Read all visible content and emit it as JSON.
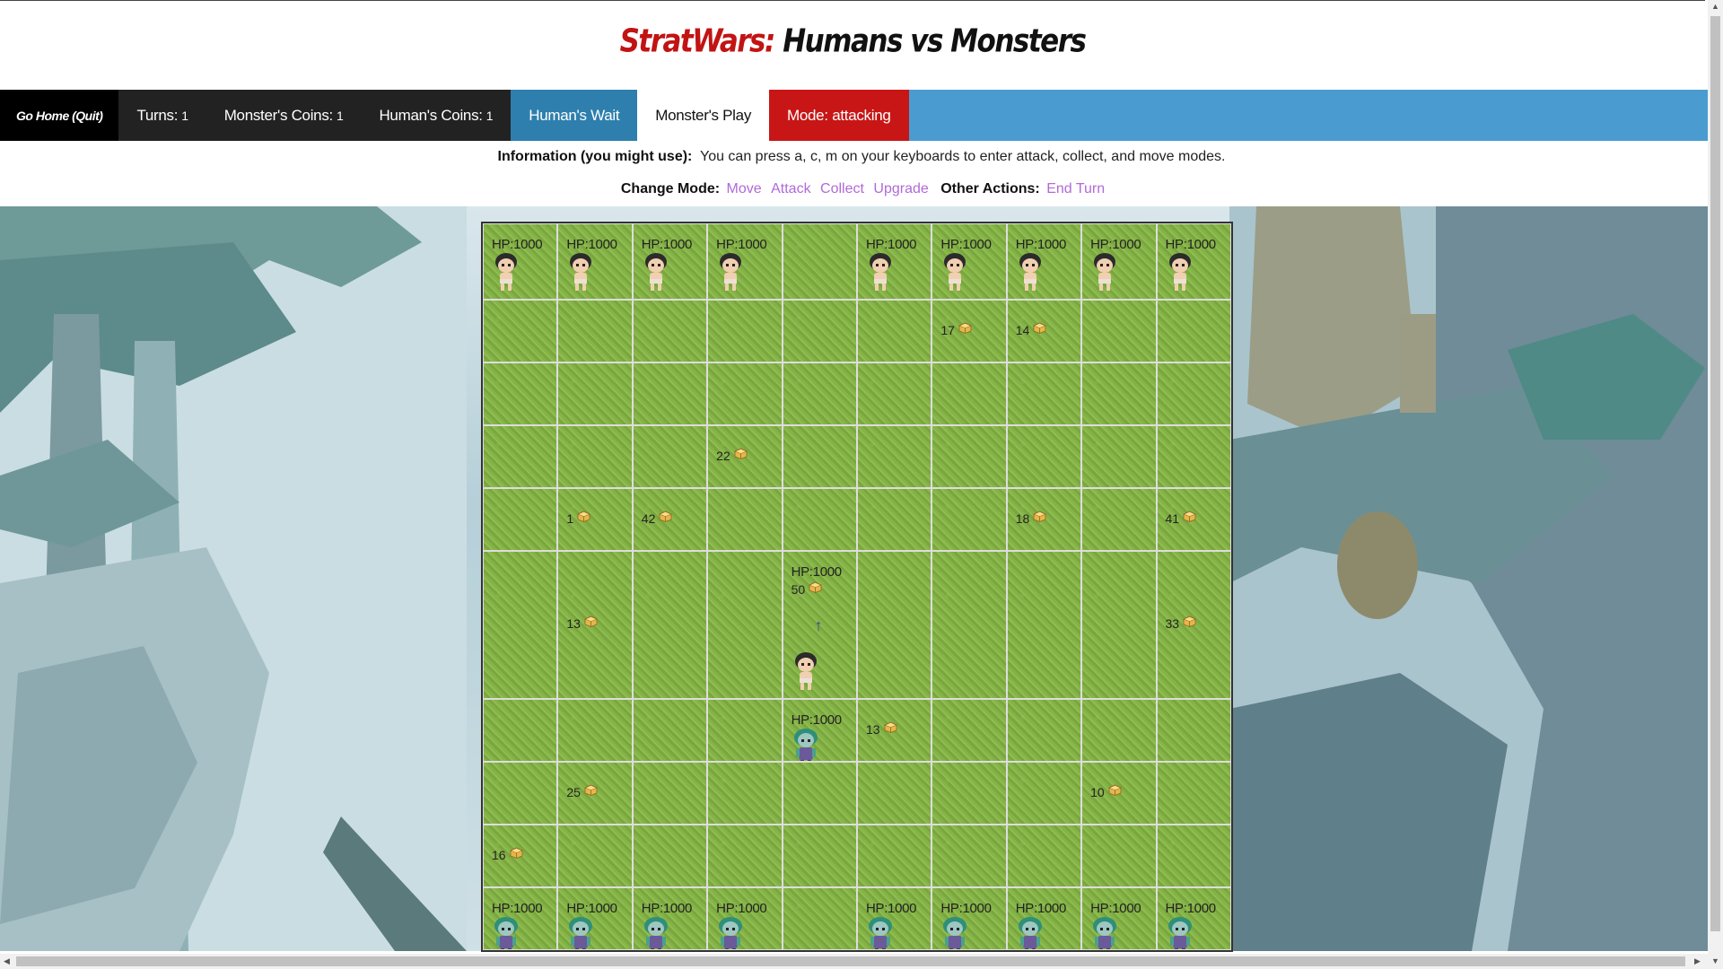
{
  "title": {
    "part1": "StratWars:",
    "part2": "Humans vs Monsters"
  },
  "nav": {
    "home": "Go Home (Quit)",
    "turns_label": "Turns:",
    "turns_value": "1",
    "monster_coins_label": "Monster's Coins:",
    "monster_coins_value": "1",
    "human_coins_label": "Human's Coins:",
    "human_coins_value": "1",
    "human_status": "Human's Wait",
    "monster_status": "Monster's Play",
    "mode_label": "Mode:",
    "mode_value": "attacking"
  },
  "info": {
    "label": "Information (you might use):",
    "text": "You can press a, c, m on your keyboards to enter attack, collect, and move modes."
  },
  "modes": {
    "label": "Change Mode:",
    "move": "Move",
    "attack": "Attack",
    "collect": "Collect",
    "upgrade": "Upgrade",
    "other_label": "Other Actions:",
    "end_turn": "End Turn"
  },
  "board": {
    "rows": [
      [
        {
          "hp": "HP:1000",
          "unit": "human"
        },
        {
          "hp": "HP:1000",
          "unit": "human"
        },
        {
          "hp": "HP:1000",
          "unit": "human"
        },
        {
          "hp": "HP:1000",
          "unit": "human"
        },
        {},
        {
          "hp": "HP:1000",
          "unit": "human"
        },
        {
          "hp": "HP:1000",
          "unit": "human"
        },
        {
          "hp": "HP:1000",
          "unit": "human"
        },
        {
          "hp": "HP:1000",
          "unit": "human"
        },
        {
          "hp": "HP:1000",
          "unit": "human"
        }
      ],
      [
        {},
        {},
        {},
        {},
        {},
        {},
        {
          "coins": "17"
        },
        {
          "coins": "14"
        },
        {},
        {}
      ],
      [
        {},
        {},
        {},
        {},
        {},
        {},
        {},
        {},
        {},
        {}
      ],
      [
        {},
        {},
        {},
        {
          "coins": "22"
        },
        {},
        {},
        {},
        {},
        {},
        {}
      ],
      [
        {},
        {
          "coins": "1"
        },
        {
          "coins": "42"
        },
        {},
        {},
        {},
        {},
        {
          "coins": "18"
        },
        {},
        {
          "coins": "41"
        }
      ],
      [
        {},
        {
          "coins": "13"
        },
        {},
        {},
        {
          "hp": "HP:1000",
          "coins": "50",
          "unit": "human",
          "arrow": true
        },
        {},
        {},
        {},
        {},
        {
          "coins": "33"
        }
      ],
      [
        {},
        {},
        {},
        {},
        {
          "hp": "HP:1000",
          "unit": "monster"
        },
        {
          "coins": "13"
        },
        {},
        {},
        {},
        {}
      ],
      [
        {},
        {
          "coins": "25"
        },
        {},
        {},
        {},
        {},
        {},
        {},
        {
          "coins": "10"
        },
        {}
      ],
      [
        {
          "coins": "16"
        },
        {},
        {},
        {},
        {},
        {},
        {},
        {},
        {},
        {}
      ],
      [
        {
          "hp": "HP:1000",
          "unit": "monster"
        },
        {
          "hp": "HP:1000",
          "unit": "monster"
        },
        {
          "hp": "HP:1000",
          "unit": "monster"
        },
        {
          "hp": "HP:1000",
          "unit": "monster"
        },
        {},
        {
          "hp": "HP:1000",
          "unit": "monster"
        },
        {
          "hp": "HP:1000",
          "unit": "monster"
        },
        {
          "hp": "HP:1000",
          "unit": "monster"
        },
        {
          "hp": "HP:1000",
          "unit": "monster"
        },
        {
          "hp": "HP:1000",
          "unit": "monster"
        }
      ]
    ]
  },
  "colors": {
    "title_red": "#c21313",
    "nav_blue": "#4a9cd0",
    "mode_red": "#c81616",
    "link_purple": "#b06ad8"
  }
}
